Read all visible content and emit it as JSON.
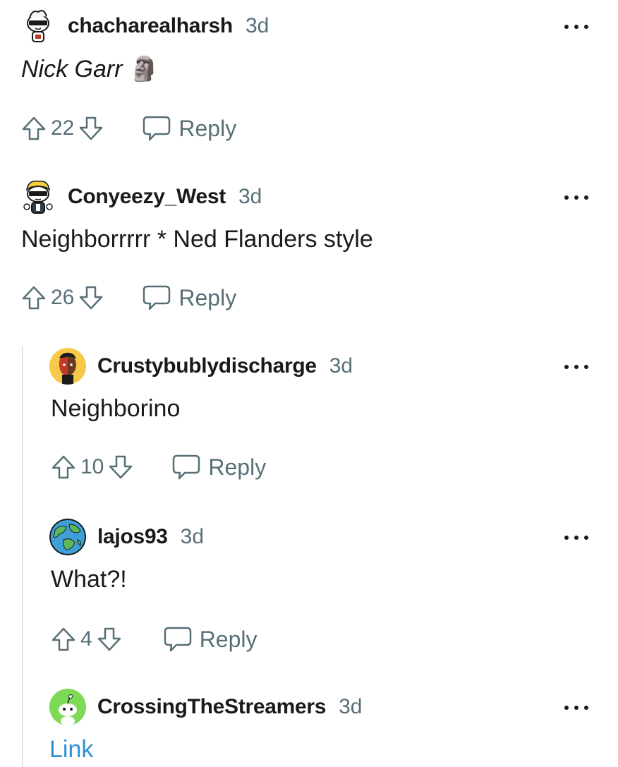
{
  "comments": [
    {
      "username": "chacharealharsh",
      "time": "3d",
      "body": "Nick Garr",
      "emoji": "🗿",
      "score": "22",
      "reply_label": "Reply"
    },
    {
      "username": "Conyeezy_West",
      "time": "3d",
      "body": "Neighborrrrr * Ned Flanders style",
      "score": "26",
      "reply_label": "Reply"
    },
    {
      "username": "Crustybublydischarge",
      "time": "3d",
      "body": "Neighborino",
      "score": "10",
      "reply_label": "Reply"
    },
    {
      "username": "lajos93",
      "time": "3d",
      "body": "What?!",
      "score": "4",
      "reply_label": "Reply"
    },
    {
      "username": "CrossingTheStreamers",
      "time": "3d",
      "body": "Link"
    }
  ],
  "colors": {
    "text": "#1a1a1b",
    "meta": "#576f76",
    "link": "#2e8fd6",
    "thread_line": "#e3e6e8"
  }
}
